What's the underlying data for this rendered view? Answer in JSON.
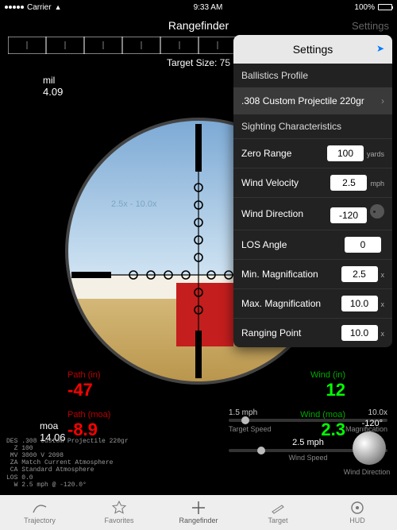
{
  "status": {
    "carrier": "Carrier",
    "time": "9:33 AM",
    "battery": "100%"
  },
  "nav": {
    "title": "Rangefinder",
    "settings": "Settings"
  },
  "target_size": {
    "label": "Target Size: ",
    "value": "75"
  },
  "mil": {
    "label": "mil",
    "value": "4.09"
  },
  "moa": {
    "label": "moa",
    "value": "14.06"
  },
  "zoom_range": "2.5x - 10.0x",
  "readouts": {
    "path_in": {
      "label": "Path (in)",
      "value": "-47"
    },
    "wind_in": {
      "label": "Wind (in)",
      "value": "12"
    },
    "path_moa": {
      "label": "Path (moa)",
      "value": "-8.9"
    },
    "wind_moa": {
      "label": "Wind (moa)",
      "value": "2.3"
    }
  },
  "controls": {
    "target_speed": {
      "left": "1.5 mph",
      "label": "Target Speed"
    },
    "magnification": {
      "right": "10.0x",
      "label": "Magnification"
    },
    "wind_speed": {
      "value": "2.5 mph",
      "label": "Wind Speed"
    },
    "wind_direction": {
      "value": "-120°",
      "label": "Wind Direction"
    }
  },
  "des": "DES .308 Custom Projectile 220gr\n  Z 100\n MV 3000 V 2098\n ZA Match Current Atmosphere\n CA Standard Atmosphere\nLOS 0.0\n  W 2.5 mph @ -120.0°",
  "tabs": [
    "Trajectory",
    "Favorites",
    "Rangefinder",
    "Target",
    "HUD"
  ],
  "popover": {
    "title": "Settings",
    "section1": "Ballistics Profile",
    "profile": ".308 Custom Projectile 220gr",
    "section2": "Sighting Characteristics",
    "rows": [
      {
        "label": "Zero Range",
        "value": "100",
        "unit": "yards"
      },
      {
        "label": "Wind Velocity",
        "value": "2.5",
        "unit": "mph"
      },
      {
        "label": "Wind Direction",
        "value": "-120",
        "unit": ""
      },
      {
        "label": "LOS Angle",
        "value": "0",
        "unit": ""
      },
      {
        "label": "Min. Magnification",
        "value": "2.5",
        "unit": "x"
      },
      {
        "label": "Max. Magnification",
        "value": "10.0",
        "unit": "x"
      },
      {
        "label": "Ranging Point",
        "value": "10.0",
        "unit": "x"
      }
    ]
  }
}
